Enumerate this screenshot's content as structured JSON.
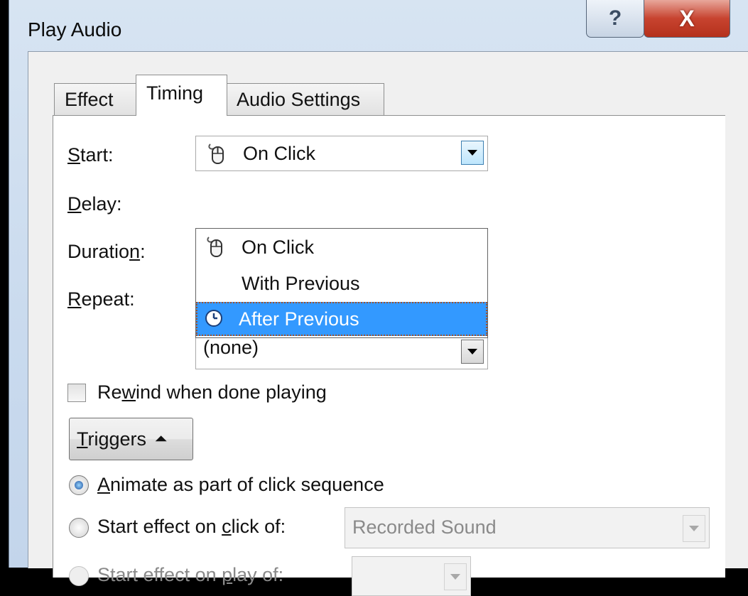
{
  "window": {
    "title": "Play Audio",
    "help_glyph": "?",
    "close_glyph": "X"
  },
  "tabs": [
    {
      "label": "Effect",
      "active": false
    },
    {
      "label": "Timing",
      "active": true
    },
    {
      "label": "Audio Settings",
      "active": false
    }
  ],
  "timing": {
    "start_label_key": "S",
    "start_label_rest": "tart:",
    "start_value": "On Click",
    "delay_label_key": "D",
    "delay_label_rest": "elay:",
    "duration_label_pre": "Duratio",
    "duration_label_key": "n",
    "duration_label_post": ":",
    "repeat_label_key": "R",
    "repeat_label_rest": "epeat:",
    "repeat_value": "(none)",
    "start_options": [
      "On Click",
      "With Previous",
      "After Previous"
    ],
    "start_highlighted": "After Previous",
    "rewind_pre": "Re",
    "rewind_key": "w",
    "rewind_post": "ind when done playing",
    "rewind_checked": false
  },
  "triggers": {
    "button_key": "T",
    "button_rest": "riggers",
    "button_glyph": "⏶",
    "animate_key": "A",
    "animate_rest": "nimate as part of click sequence",
    "animate_selected": true,
    "click_pre": "Start effect on ",
    "click_key": "c",
    "click_post": "lick of:",
    "click_value": "Recorded Sound",
    "play_pre": "Start effect on ",
    "play_key": "p",
    "play_post": "lay of:",
    "play_value": ""
  },
  "icons": {
    "mouse": "mouse-icon",
    "clock": "clock-icon",
    "help": "help-icon",
    "close": "close-icon"
  },
  "colors": {
    "selection": "#3399ff",
    "close_button": "#c7432f",
    "title_bar": "#c9daee"
  }
}
